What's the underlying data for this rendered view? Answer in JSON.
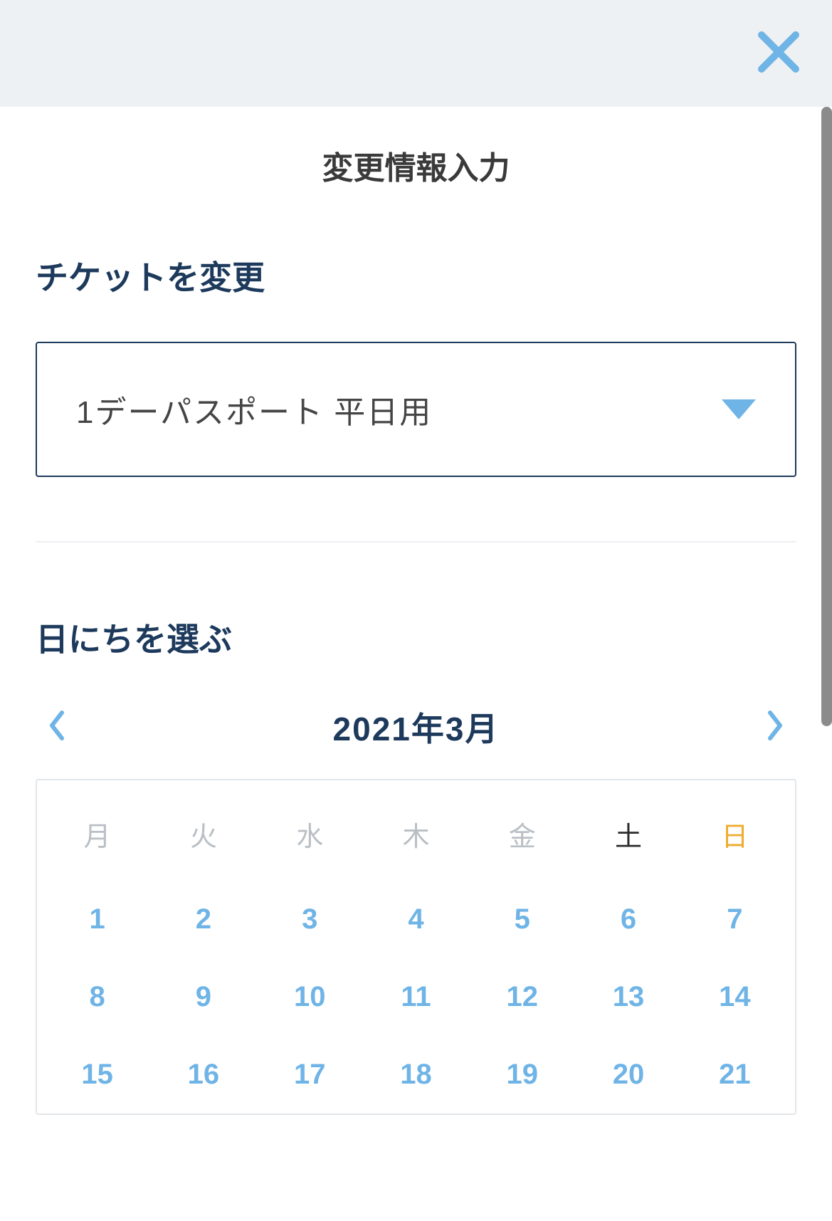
{
  "page_title": "変更情報入力",
  "section_ticket": "チケットを変更",
  "ticket_select": {
    "value": "1デーパスポート 平日用"
  },
  "section_date": "日にちを選ぶ",
  "calendar": {
    "month_label": "2021年3月",
    "weekdays": [
      "月",
      "火",
      "水",
      "木",
      "金",
      "土",
      "日"
    ],
    "rows": [
      [
        "1",
        "2",
        "3",
        "4",
        "5",
        "6",
        "7"
      ],
      [
        "8",
        "9",
        "10",
        "11",
        "12",
        "13",
        "14"
      ],
      [
        "15",
        "16",
        "17",
        "18",
        "19",
        "20",
        "21"
      ]
    ]
  },
  "colors": {
    "accent_blue": "#6fb4e6",
    "heading_navy": "#1d3a5c",
    "sunday_orange": "#f0ac2f"
  }
}
